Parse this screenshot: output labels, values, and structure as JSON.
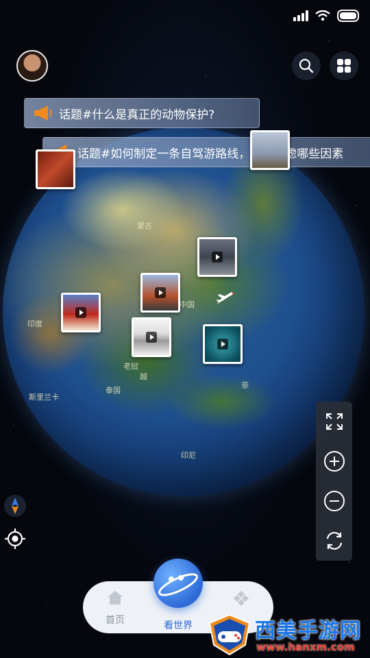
{
  "topics": [
    {
      "text": "话题#什么是真正的动物保护?"
    },
    {
      "text": "话题#如何制定一条自驾游路线，需要考虑哪些因素"
    }
  ],
  "map_labels": {
    "mongolia": "蒙古",
    "china": "中国",
    "india": "印度",
    "sri_lanka": "斯里兰卡",
    "indonesia": "印尼",
    "philippines": "菲",
    "vietnam": "越",
    "laos": "老挝",
    "thailand": "泰国"
  },
  "nav": {
    "home_label": "首页",
    "world_label": "看世界",
    "games_label": ""
  },
  "watermark": {
    "title": "西美手游网",
    "url": "www.hanxm.com"
  },
  "colors": {
    "accent": "#2d6ad8",
    "nav_bg": "#eef1f6",
    "banner_bg": "#8fa3c4"
  }
}
